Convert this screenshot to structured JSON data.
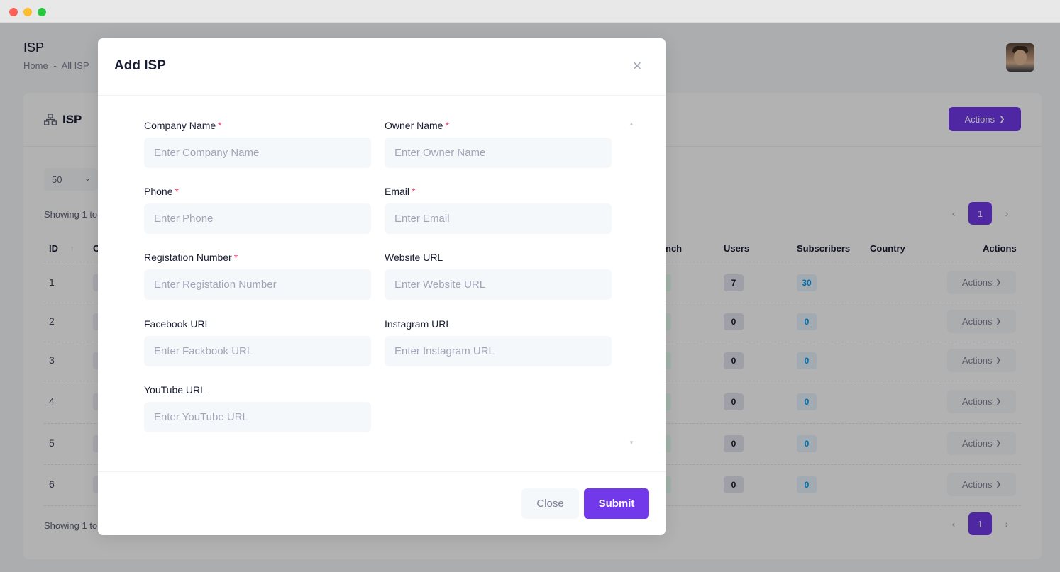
{
  "page": {
    "title": "ISP",
    "breadcrumb": [
      "Home",
      "-",
      "All ISP"
    ]
  },
  "card": {
    "title": "ISP",
    "actions_label": "Actions",
    "per_page": "50",
    "showing_text": "Showing 1 to",
    "pagination": {
      "current": "1"
    }
  },
  "table": {
    "visible_headers": {
      "id": "ID",
      "c": "C",
      "branch": "nch",
      "users": "Users",
      "subscribers": "Subscribers",
      "country": "Country",
      "actions": "Actions"
    },
    "rows": [
      {
        "id": "1",
        "users": "7",
        "subscribers": "30",
        "actions": "Actions"
      },
      {
        "id": "2",
        "users": "0",
        "subscribers": "0",
        "actions": "Actions"
      },
      {
        "id": "3",
        "users": "0",
        "subscribers": "0",
        "actions": "Actions"
      },
      {
        "id": "4",
        "users": "0",
        "subscribers": "0",
        "actions": "Actions"
      },
      {
        "id": "5",
        "users": "0",
        "subscribers": "0",
        "actions": "Actions"
      },
      {
        "id": "6",
        "users": "0",
        "subscribers": "0",
        "actions": "Actions"
      }
    ]
  },
  "modal": {
    "title": "Add ISP",
    "fields": {
      "company_name": {
        "label": "Company Name",
        "required": "*",
        "placeholder": "Enter Company Name"
      },
      "owner_name": {
        "label": "Owner Name",
        "required": "*",
        "placeholder": "Enter Owner Name"
      },
      "phone": {
        "label": "Phone",
        "required": "*",
        "placeholder": "Enter Phone"
      },
      "email": {
        "label": "Email",
        "required": "*",
        "placeholder": "Enter Email"
      },
      "registration_number": {
        "label": "Registation Number",
        "required": "*",
        "placeholder": "Enter Registation Number"
      },
      "website_url": {
        "label": "Website URL",
        "placeholder": "Enter Website URL"
      },
      "facebook_url": {
        "label": "Facebook URL",
        "placeholder": "Enter Fackbook URL"
      },
      "instagram_url": {
        "label": "Instagram URL",
        "placeholder": "Enter Instagram URL"
      },
      "youtube_url": {
        "label": "YouTube URL",
        "placeholder": "Enter YouTube URL"
      }
    },
    "close_label": "Close",
    "submit_label": "Submit"
  },
  "colors": {
    "primary": "#7239ea",
    "required": "#f1416c"
  }
}
